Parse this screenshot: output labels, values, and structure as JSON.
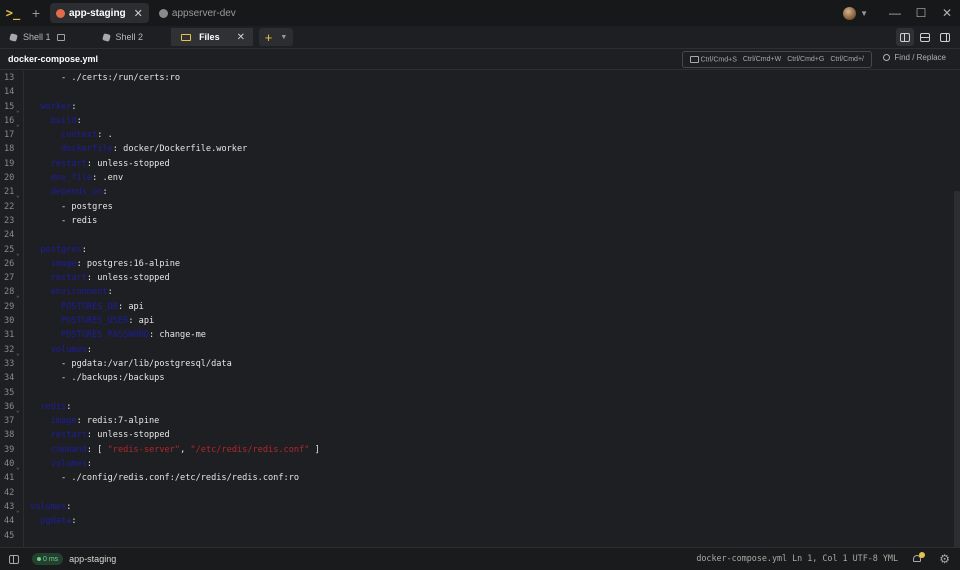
{
  "titlebar": {
    "tabs": [
      {
        "label": "app-staging",
        "color": "#e26b4a",
        "active": true
      },
      {
        "label": "appserver-dev",
        "color": "#8a8a8a",
        "active": false
      }
    ]
  },
  "session_tabs": {
    "shell1": "Shell 1",
    "shell2": "Shell 2",
    "files": "Files"
  },
  "filebar": {
    "filename": "docker-compose.yml",
    "shortcuts": [
      "Ctrl/Cmd+S",
      "Ctrl/Cmd+W",
      "Ctrl/Cmd+G",
      "Ctrl/Cmd+/"
    ],
    "find_replace": "Find / Replace"
  },
  "editor": {
    "lines": [
      {
        "n": "13",
        "fold": false,
        "indent": "      ",
        "parts": [
          [
            "t",
            "- ./certs:/run/certs:ro"
          ]
        ]
      },
      {
        "n": "14",
        "fold": false,
        "indent": "",
        "parts": []
      },
      {
        "n": "15",
        "fold": true,
        "indent": "  ",
        "parts": [
          [
            "k",
            "worker"
          ],
          [
            "t",
            ":"
          ]
        ]
      },
      {
        "n": "16",
        "fold": true,
        "indent": "    ",
        "parts": [
          [
            "k",
            "build"
          ],
          [
            "t",
            ":"
          ]
        ]
      },
      {
        "n": "17",
        "fold": false,
        "indent": "      ",
        "parts": [
          [
            "k",
            "context"
          ],
          [
            "t",
            ": ."
          ]
        ]
      },
      {
        "n": "18",
        "fold": false,
        "indent": "      ",
        "parts": [
          [
            "k",
            "dockerfile"
          ],
          [
            "t",
            ": docker/Dockerfile.worker"
          ]
        ]
      },
      {
        "n": "19",
        "fold": false,
        "indent": "    ",
        "parts": [
          [
            "k",
            "restart"
          ],
          [
            "t",
            ": unless-stopped"
          ]
        ]
      },
      {
        "n": "20",
        "fold": false,
        "indent": "    ",
        "parts": [
          [
            "k",
            "env_file"
          ],
          [
            "t",
            ": .env"
          ]
        ]
      },
      {
        "n": "21",
        "fold": true,
        "indent": "    ",
        "parts": [
          [
            "k",
            "depends_on"
          ],
          [
            "t",
            ":"
          ]
        ]
      },
      {
        "n": "22",
        "fold": false,
        "indent": "      ",
        "parts": [
          [
            "t",
            "- postgres"
          ]
        ]
      },
      {
        "n": "23",
        "fold": false,
        "indent": "      ",
        "parts": [
          [
            "t",
            "- redis"
          ]
        ]
      },
      {
        "n": "24",
        "fold": false,
        "indent": "",
        "parts": []
      },
      {
        "n": "25",
        "fold": true,
        "indent": "  ",
        "parts": [
          [
            "k",
            "postgres"
          ],
          [
            "t",
            ":"
          ]
        ]
      },
      {
        "n": "26",
        "fold": false,
        "indent": "    ",
        "parts": [
          [
            "k",
            "image"
          ],
          [
            "t",
            ": postgres:16-alpine"
          ]
        ]
      },
      {
        "n": "27",
        "fold": false,
        "indent": "    ",
        "parts": [
          [
            "k",
            "restart"
          ],
          [
            "t",
            ": unless-stopped"
          ]
        ]
      },
      {
        "n": "28",
        "fold": true,
        "indent": "    ",
        "parts": [
          [
            "k",
            "environment"
          ],
          [
            "t",
            ":"
          ]
        ]
      },
      {
        "n": "29",
        "fold": false,
        "indent": "      ",
        "parts": [
          [
            "k",
            "POSTGRES_DB"
          ],
          [
            "t",
            ": api"
          ]
        ]
      },
      {
        "n": "30",
        "fold": false,
        "indent": "      ",
        "parts": [
          [
            "k",
            "POSTGRES_USER"
          ],
          [
            "t",
            ": api"
          ]
        ]
      },
      {
        "n": "31",
        "fold": false,
        "indent": "      ",
        "parts": [
          [
            "k",
            "POSTGRES_PASSWORD"
          ],
          [
            "t",
            ": change-me"
          ]
        ]
      },
      {
        "n": "32",
        "fold": true,
        "indent": "    ",
        "parts": [
          [
            "k",
            "volumes"
          ],
          [
            "t",
            ":"
          ]
        ]
      },
      {
        "n": "33",
        "fold": false,
        "indent": "      ",
        "parts": [
          [
            "t",
            "- pgdata:/var/lib/postgresql/data"
          ]
        ]
      },
      {
        "n": "34",
        "fold": false,
        "indent": "      ",
        "parts": [
          [
            "t",
            "- ./backups:/backups"
          ]
        ]
      },
      {
        "n": "35",
        "fold": false,
        "indent": "",
        "parts": []
      },
      {
        "n": "36",
        "fold": true,
        "indent": "  ",
        "parts": [
          [
            "k",
            "redis"
          ],
          [
            "t",
            ":"
          ]
        ]
      },
      {
        "n": "37",
        "fold": false,
        "indent": "    ",
        "parts": [
          [
            "k",
            "image"
          ],
          [
            "t",
            ": redis:7-alpine"
          ]
        ]
      },
      {
        "n": "38",
        "fold": false,
        "indent": "    ",
        "parts": [
          [
            "k",
            "restart"
          ],
          [
            "t",
            ": unless-stopped"
          ]
        ]
      },
      {
        "n": "39",
        "fold": false,
        "indent": "    ",
        "parts": [
          [
            "k",
            "command"
          ],
          [
            "t",
            ": [ "
          ],
          [
            "s",
            "\"redis-server\""
          ],
          [
            "t",
            ", "
          ],
          [
            "s",
            "\"/etc/redis/redis.conf\""
          ],
          [
            "t",
            " ]"
          ]
        ]
      },
      {
        "n": "40",
        "fold": true,
        "indent": "    ",
        "parts": [
          [
            "k",
            "volumes"
          ],
          [
            "t",
            ":"
          ]
        ]
      },
      {
        "n": "41",
        "fold": false,
        "indent": "      ",
        "parts": [
          [
            "t",
            "- ./config/redis.conf:/etc/redis/redis.conf:ro"
          ]
        ]
      },
      {
        "n": "42",
        "fold": false,
        "indent": "",
        "parts": []
      },
      {
        "n": "43",
        "fold": true,
        "indent": "",
        "parts": [
          [
            "k",
            "volumes"
          ],
          [
            "t",
            ":"
          ]
        ]
      },
      {
        "n": "44",
        "fold": false,
        "indent": "  ",
        "parts": [
          [
            "k",
            "pgdata"
          ],
          [
            "t",
            ":"
          ]
        ]
      },
      {
        "n": "45",
        "fold": false,
        "indent": "",
        "parts": []
      }
    ]
  },
  "statusbar": {
    "badge": "0 ms",
    "host": "app-staging",
    "right": "docker-compose.yml  Ln 1, Col 1  UTF-8  YML"
  },
  "colors": {
    "key": "#1d1d9e",
    "string": "#b3262a",
    "accent": "#e8c24a"
  }
}
